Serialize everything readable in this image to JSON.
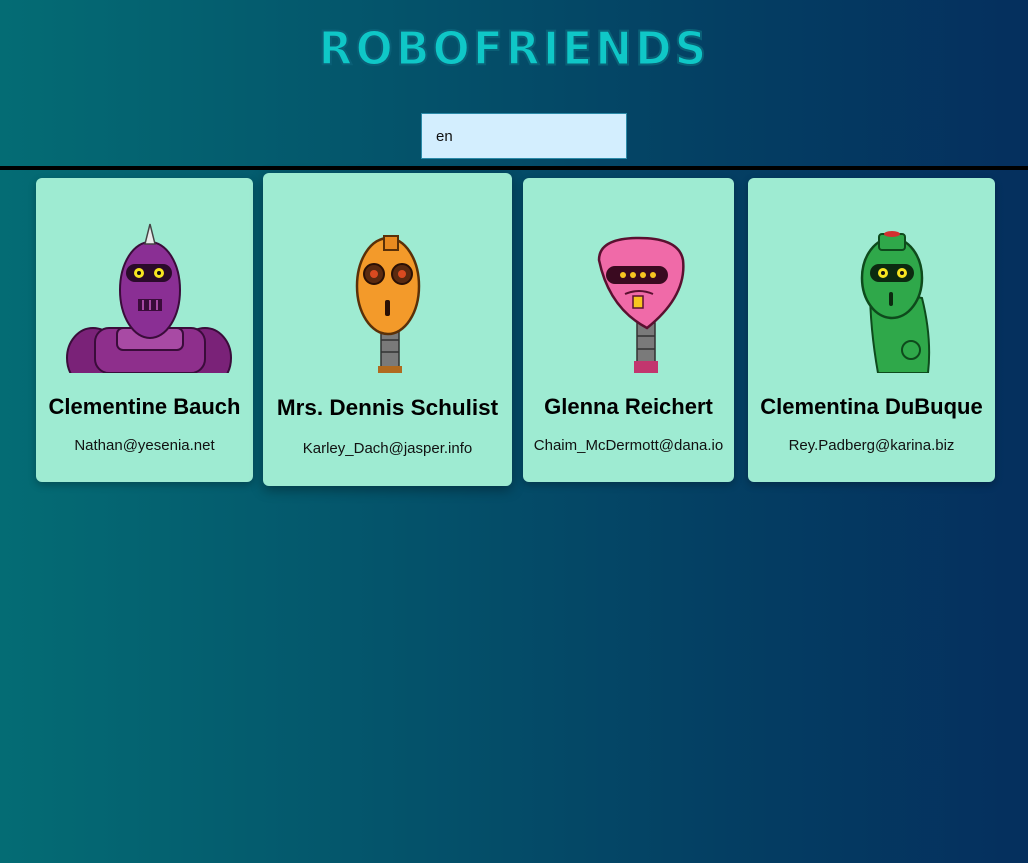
{
  "app": {
    "title": "ROBOFRIENDS"
  },
  "search": {
    "value": "en",
    "placeholder": "search robots"
  },
  "robots": [
    {
      "name": "Clementine Bauch",
      "email": "Nathan@yesenia.net",
      "color": "#7b2a8c"
    },
    {
      "name": "Mrs. Dennis Schulist",
      "email": "Karley_Dach@jasper.info",
      "color": "#f39a2a"
    },
    {
      "name": "Glenna Reichert",
      "email": "Chaim_McDermott@dana.io",
      "color": "#f06aa8"
    },
    {
      "name": "Clementina DuBuque",
      "email": "Rey.Padberg@karina.biz",
      "color": "#2fa84a"
    }
  ],
  "colors": {
    "card_background": "#9eebd2",
    "title_color": "#0fc7c7",
    "search_background": "#d3eefe"
  }
}
